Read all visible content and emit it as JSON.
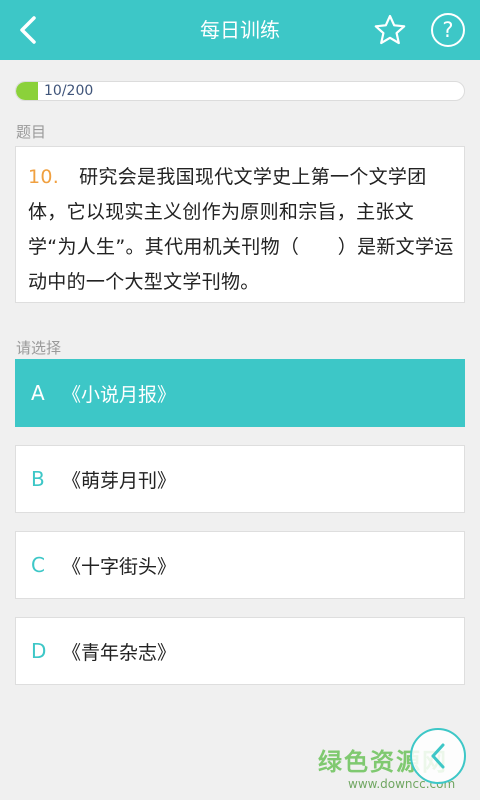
{
  "header": {
    "title": "每日训练"
  },
  "progress": {
    "text": "10/200",
    "current": 10,
    "total": 200
  },
  "question": {
    "section_label": "题目",
    "number": "10.",
    "text": "研究会是我国现代文学史上第一个文学团体，它以现实主义创作为原则和宗旨，主张文学“为人生”。其代用机关刊物（　　）是新文学运动中的一个大型文学刊物。"
  },
  "choices": {
    "section_label": "请选择",
    "selected_index": 0,
    "options": [
      {
        "letter": "A",
        "text": "《小说月报》"
      },
      {
        "letter": "B",
        "text": "《萌芽月刊》"
      },
      {
        "letter": "C",
        "text": "《十字街头》"
      },
      {
        "letter": "D",
        "text": "《青年杂志》"
      }
    ]
  },
  "watermark": {
    "title": "绿色资源网",
    "url": "www.downcc.com"
  },
  "colors": {
    "accent": "#3dc7c7",
    "progress": "#8bd13a",
    "number": "#f0a040"
  }
}
